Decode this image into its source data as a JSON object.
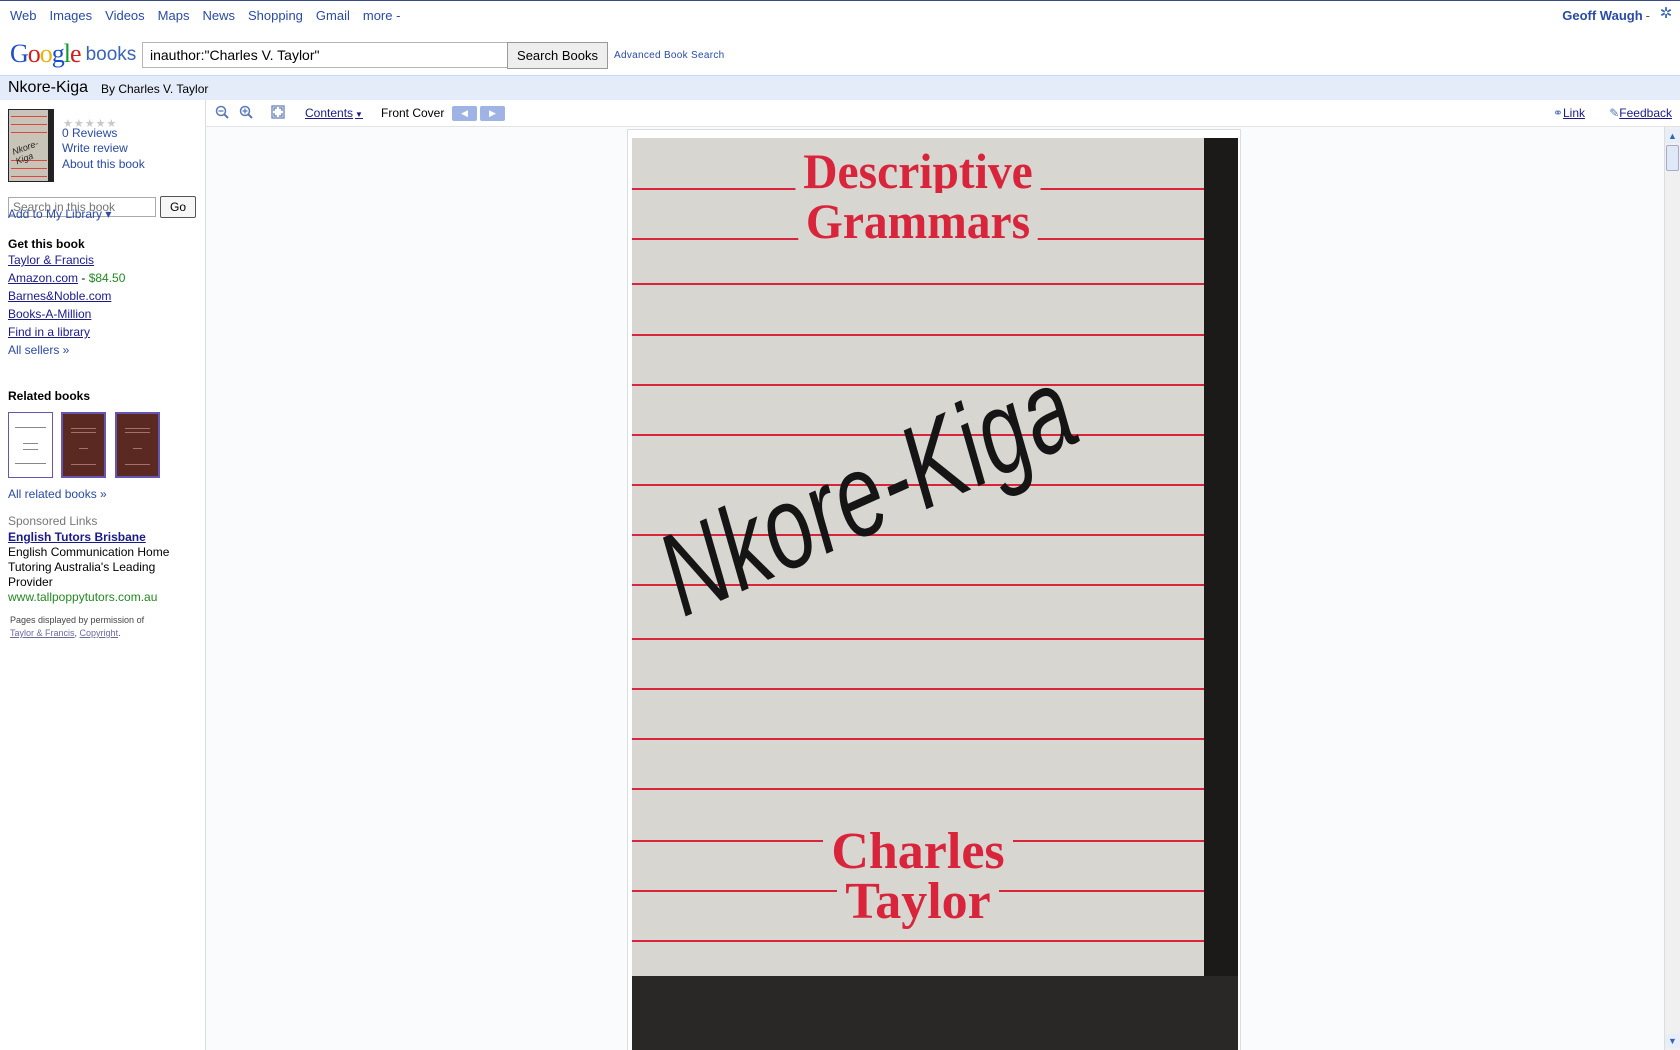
{
  "topnav": {
    "items": [
      "Web",
      "Images",
      "Videos",
      "Maps",
      "News",
      "Shopping",
      "Gmail",
      "more -"
    ],
    "user": "Geoff Waugh",
    "user_sep": "-"
  },
  "header": {
    "logo_books": "books",
    "search_value": "inauthor:\"Charles V. Taylor\"",
    "search_button": "Search Books",
    "advanced_link": "Advanced Book Search"
  },
  "book": {
    "title": "Nkore-Kiga",
    "byline": "By Charles V. Taylor"
  },
  "sidebar": {
    "thumb_text": "Nkore-Kiga",
    "stars": "★★★★★",
    "reviews": "0 Reviews",
    "write_review": "Write review",
    "about": "About this book",
    "search_placeholder": "Search in this book",
    "go_button": "Go",
    "add_library": "Add to My Library ▾",
    "get_heading": "Get this book",
    "sellers": {
      "taylor_francis": "Taylor & Francis",
      "amazon": "Amazon.com",
      "amazon_sep": " - ",
      "amazon_price": "$84.50",
      "bn": "Barnes&Noble.com",
      "bam": "Books-A-Million",
      "library": "Find in a library",
      "all": "All sellers »"
    },
    "related_heading": "Related books",
    "all_related": "All related books »",
    "sponsored_heading": "Sponsored Links",
    "ad_title": "English Tutors Brisbane",
    "ad_body": "English Communication Home Tutoring Australia's Leading Provider",
    "ad_url": "www.tallpoppytutors.com.au",
    "permission_text": "Pages displayed by permission of",
    "permission_publisher": "Taylor & Francis",
    "permission_copyright": "Copyright"
  },
  "toolbar": {
    "contents": "Contents",
    "page_label": "Front Cover",
    "link": "Link",
    "feedback": "Feedback"
  },
  "cover": {
    "series_line1": "Descriptive",
    "series_line2": "Grammars",
    "title": "Nkore-Kiga",
    "author_line1": "Charles",
    "author_line2": "Taylor"
  }
}
